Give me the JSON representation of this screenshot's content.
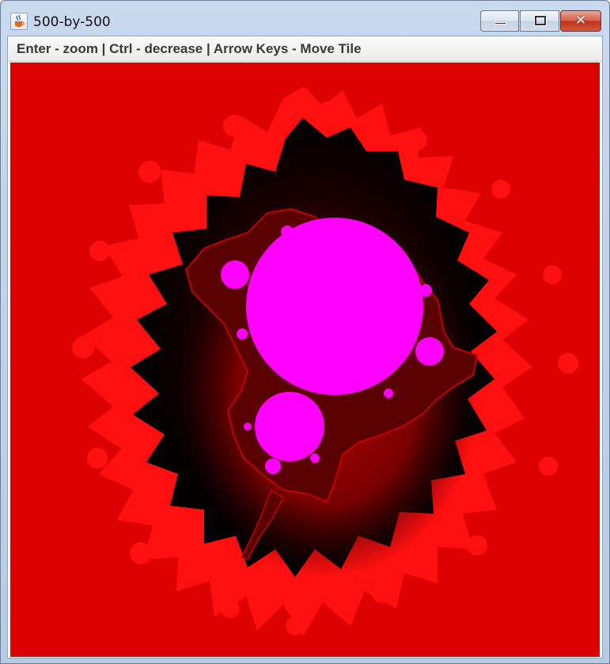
{
  "window": {
    "title": "500-by-500",
    "icon": "java-cup-icon",
    "controls": {
      "minimize_icon": "minimize-icon",
      "maximize_icon": "maximize-icon",
      "close_icon": "close-icon",
      "close_glyph": "✕"
    }
  },
  "hint_bar": {
    "text": "Enter - zoom | Ctrl - decrease | Arrow Keys - Move Tile"
  },
  "fractal": {
    "description_colors": {
      "background": "#dc0000",
      "outer_band": "#ff1a1a",
      "dark_zone": "#1a0000",
      "set_interior": "#ff00ff"
    }
  }
}
